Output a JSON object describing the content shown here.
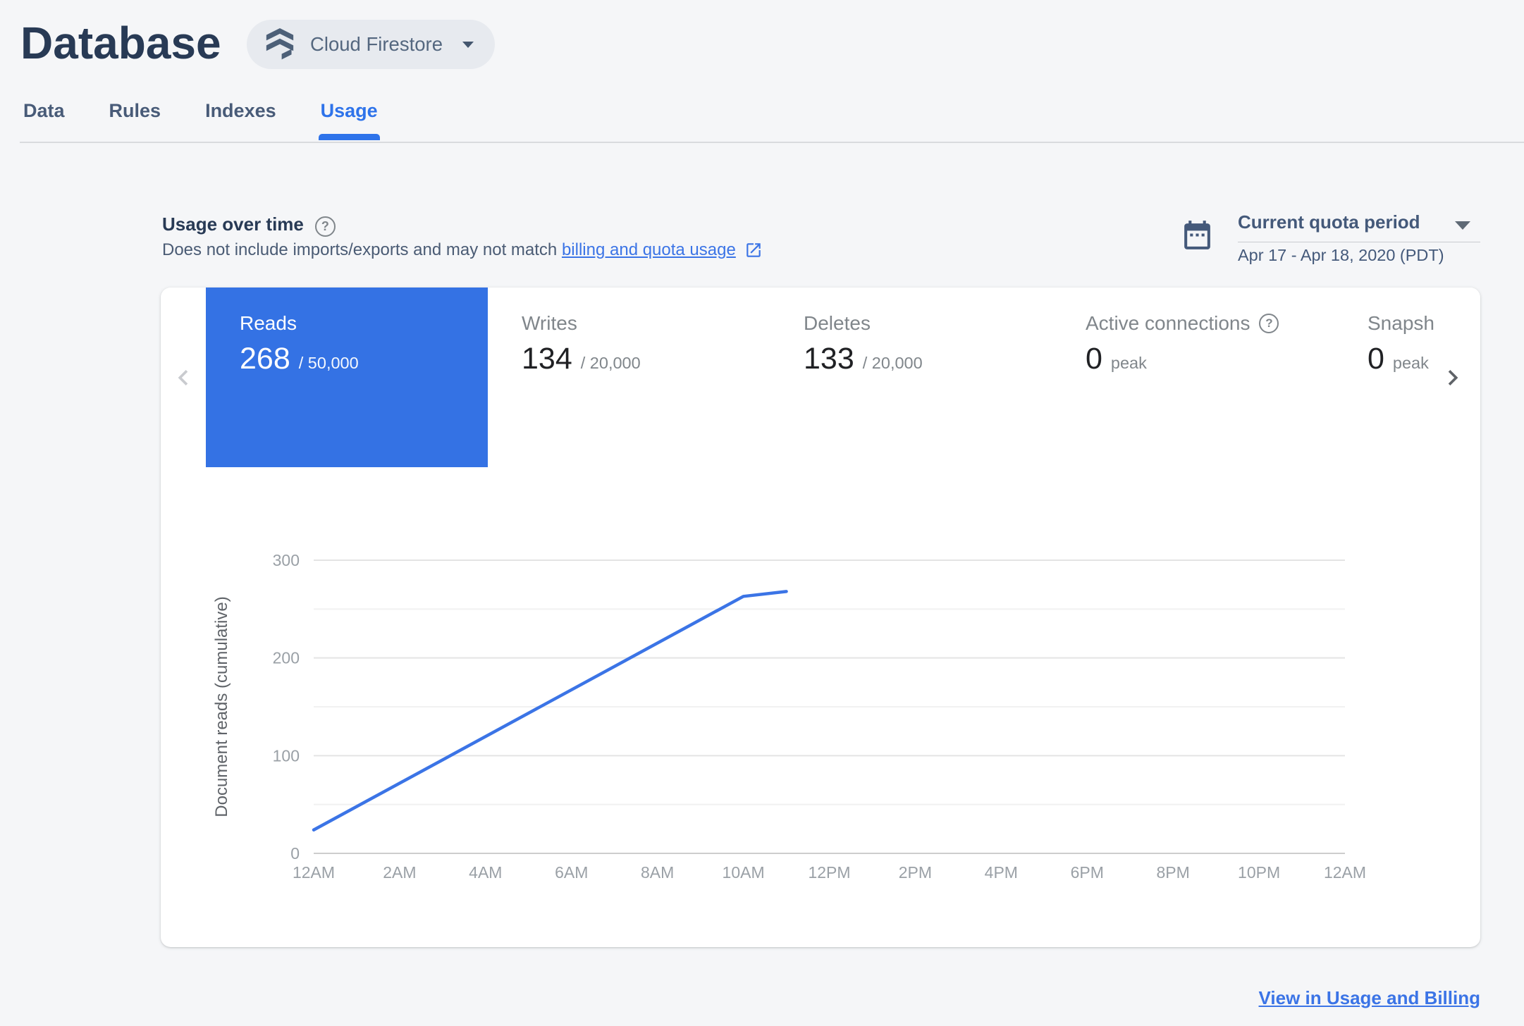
{
  "header": {
    "title": "Database",
    "product_selector": {
      "label": "Cloud Firestore"
    }
  },
  "tabs": [
    {
      "label": "Data",
      "active": false
    },
    {
      "label": "Rules",
      "active": false
    },
    {
      "label": "Indexes",
      "active": false
    },
    {
      "label": "Usage",
      "active": true
    }
  ],
  "usage_section": {
    "heading": "Usage over time",
    "subtitle_prefix": "Does not include imports/exports and may not match",
    "subtitle_link": "billing and quota usage",
    "period_selector": {
      "label": "Current quota period",
      "range": "Apr 17 - Apr 18, 2020 (PDT)"
    }
  },
  "metrics": [
    {
      "label": "Reads",
      "value": "268",
      "suffix": "/ 50,000",
      "active": true,
      "help": false
    },
    {
      "label": "Writes",
      "value": "134",
      "suffix": "/ 20,000",
      "active": false,
      "help": false
    },
    {
      "label": "Deletes",
      "value": "133",
      "suffix": "/ 20,000",
      "active": false,
      "help": false
    },
    {
      "label": "Active connections",
      "value": "0",
      "suffix": "peak",
      "active": false,
      "help": true
    },
    {
      "label": "Snapshots",
      "value": "0",
      "suffix": "peak",
      "active": false,
      "help": false
    }
  ],
  "chart_data": {
    "type": "line",
    "title": "",
    "xlabel": "",
    "ylabel": "Document reads (cumulative)",
    "x_tick_labels": [
      "12AM",
      "2AM",
      "4AM",
      "6AM",
      "8AM",
      "10AM",
      "12PM",
      "2PM",
      "4PM",
      "6PM",
      "8PM",
      "10PM",
      "12AM"
    ],
    "x_range_hours": [
      0,
      24
    ],
    "x_tick_step_hours": 2,
    "ylim": [
      0,
      300
    ],
    "y_major_ticks": [
      0,
      100,
      200,
      300
    ],
    "y_minor_step": 50,
    "grid": "horizontal",
    "legend": "none",
    "series": [
      {
        "name": "Document reads (cumulative)",
        "points_hour_value": [
          [
            0,
            24
          ],
          [
            10,
            263
          ],
          [
            11,
            268
          ]
        ]
      }
    ]
  },
  "footer": {
    "link_label": "View in Usage and Billing"
  },
  "colors": {
    "accent_blue": "#3472e4",
    "line_blue": "#3b74e6",
    "tab_active_blue": "#2e73ea",
    "title_navy": "#283a55",
    "page_bg": "#f5f6f8",
    "card_bg": "#ffffff",
    "metric_label_gray": "#80868b",
    "metric_value_dark": "#202124",
    "tick_label_gray": "#9aa0a6",
    "axis_title_gray": "#5f6368",
    "grid_major": "#e4e4e4",
    "grid_minor": "#f1f1f1",
    "grid_zero": "#cdcdcd"
  }
}
